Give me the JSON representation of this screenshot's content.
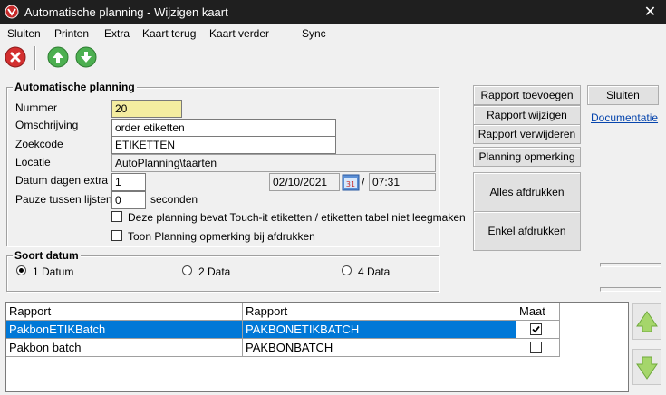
{
  "window": {
    "title": "Automatische planning - Wijzigen kaart",
    "close_glyph": "✕"
  },
  "menu": {
    "items": [
      "Sluiten",
      "Printen",
      "Extra",
      "Kaart terug",
      "Kaart verder",
      "Sync"
    ]
  },
  "toolbar": {
    "close_icon": "close-icon",
    "up_icon": "arrow-up-icon",
    "down_icon": "arrow-down-icon"
  },
  "planning": {
    "group_title": "Automatische planning",
    "nummer_label": "Nummer",
    "nummer_value": "20",
    "omschrijving_label": "Omschrijving",
    "omschrijving_value": "order etiketten",
    "zoekcode_label": "Zoekcode",
    "zoekcode_value": "ETIKETTEN",
    "locatie_label": "Locatie",
    "locatie_value": "AutoPlanning\\taarten",
    "datum_label": "Datum dagen extra",
    "datum_value": "1",
    "date_value": "02/10/2021",
    "date_sep": "/",
    "time_value": "07:31",
    "pauze_label": "Pauze tussen lijsten",
    "pauze_value": "0",
    "pauze_unit": "seconden",
    "touch_label": "Deze planning bevat Touch-it etiketten /  etiketten tabel niet leegmaken",
    "touch_checked": false,
    "toon_label": "Toon Planning opmerking bij afdrukken",
    "toon_checked": false
  },
  "buttons": {
    "rapport_toevoegen": "Rapport toevoegen",
    "rapport_wijzigen": "Rapport wijzigen",
    "rapport_verwijderen": "Rapport verwijderen",
    "planning_opmerking": "Planning opmerking",
    "alles_afdrukken": "Alles afdrukken",
    "enkel_afdrukken": "Enkel afdrukken",
    "sluiten": "Sluiten",
    "documentatie": "Documentatie"
  },
  "soort_datum": {
    "title": "Soort datum",
    "options": [
      "1 Datum",
      "2 Data",
      "4 Data"
    ],
    "selected": "1 Datum"
  },
  "grid": {
    "columns": [
      "Rapport",
      "Rapport",
      "Maat"
    ],
    "rows": [
      {
        "c1": "PakbonETIKBatch",
        "c2": "PAKBONETIKBATCH",
        "maat": true,
        "selected": true
      },
      {
        "c1": "Pakbon batch",
        "c2": "PAKBONBATCH",
        "maat": false,
        "selected": false
      }
    ]
  },
  "colors": {
    "accent": "#0078d7",
    "titlebar": "#1f1f1f",
    "yellow_field": "#f4eda0",
    "green_arrow": "#4caf50",
    "red_close": "#d32f2f"
  }
}
